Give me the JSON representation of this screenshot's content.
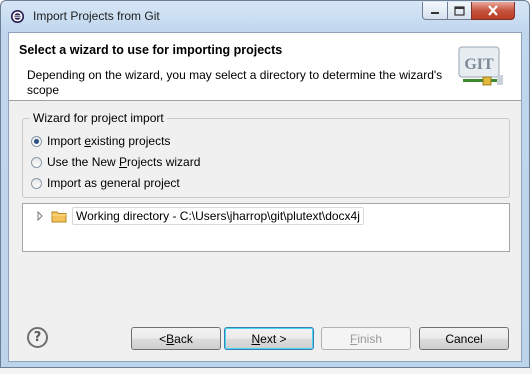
{
  "window": {
    "title": "Import Projects from Git"
  },
  "banner": {
    "title": "Select a wizard to use for importing projects",
    "description": "Depending on the wizard, you may select a directory to determine the wizard's scope",
    "logo_text": "GIT"
  },
  "wizard_group": {
    "label": "Wizard for project import",
    "options": [
      {
        "pre": "Import ",
        "mnemonic": "e",
        "post": "xisting projects",
        "checked": true
      },
      {
        "pre": "Use the New ",
        "mnemonic": "P",
        "post": "rojects wizard",
        "checked": false
      },
      {
        "pre": "Import as ",
        "mnemonic": "g",
        "post": "eneral project",
        "checked": false
      }
    ]
  },
  "tree": {
    "item_label": "Working directory - C:\\Users\\jharrop\\git\\plutext\\docx4j"
  },
  "buttons": {
    "back_pre": "< ",
    "back_mnemonic": "B",
    "back_post": "ack",
    "next_mnemonic": "N",
    "next_post": "ext >",
    "finish_mnemonic": "F",
    "finish_post": "inish",
    "cancel": "Cancel"
  },
  "colors": {
    "titlebar": "#c1d7ee",
    "close_button": "#c7553e",
    "dialog_bg": "#f0f0f0",
    "folder": "#f3c35a"
  },
  "icons": {
    "title": "eclipse-icon",
    "help": "help-icon",
    "folder": "folder-icon",
    "expander": "tree-expander-icon"
  }
}
